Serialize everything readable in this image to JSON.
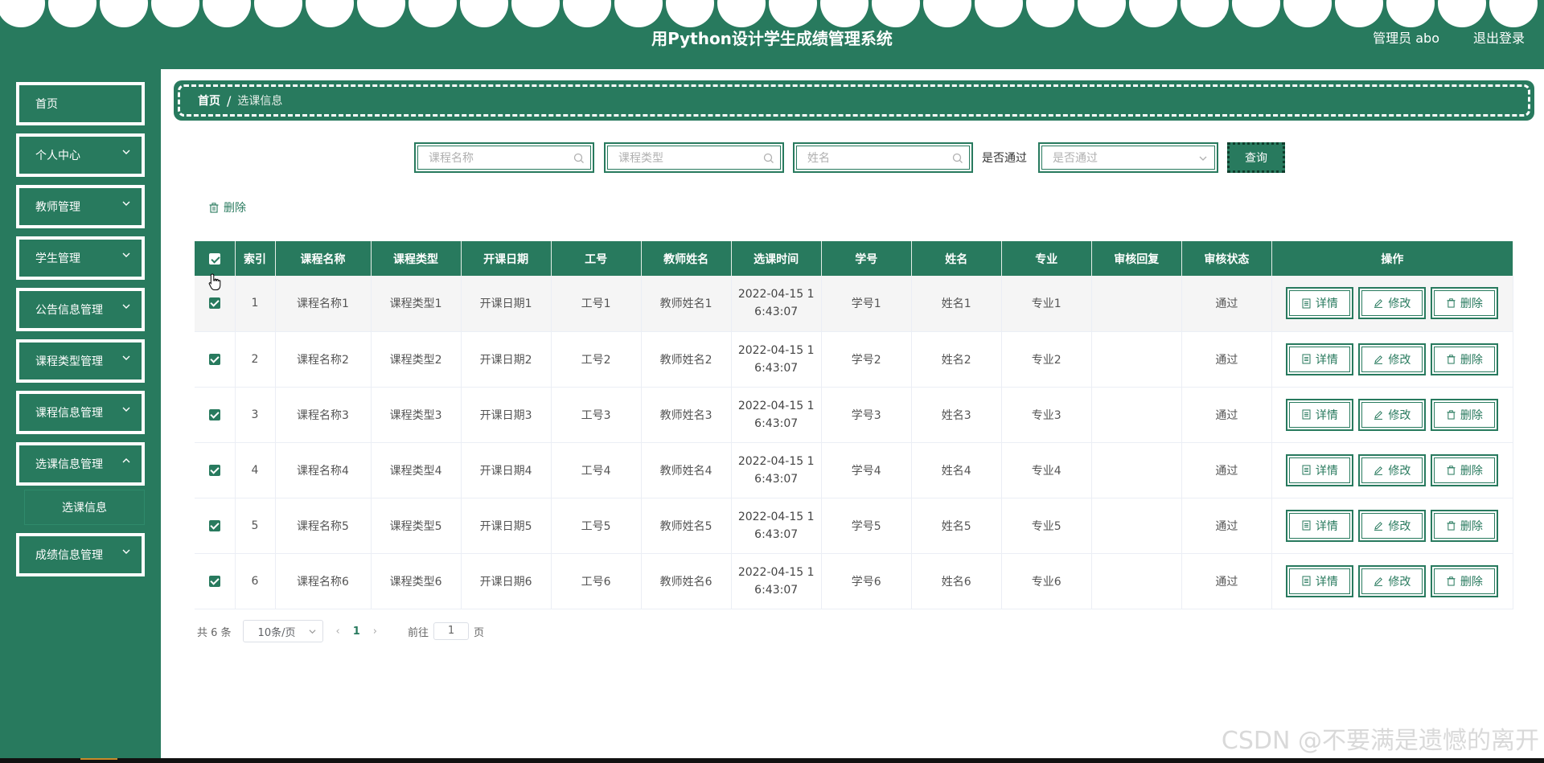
{
  "header": {
    "title": "用Python设计学生成绩管理系统",
    "user": "管理员 abo",
    "logout": "退出登录"
  },
  "sidebar": {
    "items": [
      {
        "label": "首页",
        "has_arrow": false
      },
      {
        "label": "个人中心",
        "has_arrow": true
      },
      {
        "label": "教师管理",
        "has_arrow": true
      },
      {
        "label": "学生管理",
        "has_arrow": true
      },
      {
        "label": "公告信息管理",
        "has_arrow": true
      },
      {
        "label": "课程类型管理",
        "has_arrow": true
      },
      {
        "label": "课程信息管理",
        "has_arrow": true
      },
      {
        "label": "选课信息管理",
        "has_arrow": true
      },
      {
        "label": "成绩信息管理",
        "has_arrow": true
      }
    ],
    "subitem": "选课信息"
  },
  "breadcrumb": {
    "home": "首页",
    "separator": "/",
    "current": "选课信息"
  },
  "search": {
    "course_name_placeholder": "课程名称",
    "course_type_placeholder": "课程类型",
    "name_placeholder": "姓名",
    "pass_label": "是否通过",
    "pass_placeholder": "是否通过",
    "query_button": "查询"
  },
  "toolbar": {
    "delete_label": "删除"
  },
  "table": {
    "headers": [
      "索引",
      "课程名称",
      "课程类型",
      "开课日期",
      "工号",
      "教师姓名",
      "选课时间",
      "学号",
      "姓名",
      "专业",
      "审核回复",
      "审核状态",
      "操作"
    ],
    "rows": [
      {
        "index": "1",
        "course": "课程名称1",
        "type": "课程类型1",
        "date": "开课日期1",
        "staff_no": "工号1",
        "teacher": "教师姓名1",
        "time_l1": "2022-04-15 1",
        "time_l2": "6:43:07",
        "student_no": "学号1",
        "name": "姓名1",
        "major": "专业1",
        "reply": "",
        "status": "通过"
      },
      {
        "index": "2",
        "course": "课程名称2",
        "type": "课程类型2",
        "date": "开课日期2",
        "staff_no": "工号2",
        "teacher": "教师姓名2",
        "time_l1": "2022-04-15 1",
        "time_l2": "6:43:07",
        "student_no": "学号2",
        "name": "姓名2",
        "major": "专业2",
        "reply": "",
        "status": "通过"
      },
      {
        "index": "3",
        "course": "课程名称3",
        "type": "课程类型3",
        "date": "开课日期3",
        "staff_no": "工号3",
        "teacher": "教师姓名3",
        "time_l1": "2022-04-15 1",
        "time_l2": "6:43:07",
        "student_no": "学号3",
        "name": "姓名3",
        "major": "专业3",
        "reply": "",
        "status": "通过"
      },
      {
        "index": "4",
        "course": "课程名称4",
        "type": "课程类型4",
        "date": "开课日期4",
        "staff_no": "工号4",
        "teacher": "教师姓名4",
        "time_l1": "2022-04-15 1",
        "time_l2": "6:43:07",
        "student_no": "学号4",
        "name": "姓名4",
        "major": "专业4",
        "reply": "",
        "status": "通过"
      },
      {
        "index": "5",
        "course": "课程名称5",
        "type": "课程类型5",
        "date": "开课日期5",
        "staff_no": "工号5",
        "teacher": "教师姓名5",
        "time_l1": "2022-04-15 1",
        "time_l2": "6:43:07",
        "student_no": "学号5",
        "name": "姓名5",
        "major": "专业5",
        "reply": "",
        "status": "通过"
      },
      {
        "index": "6",
        "course": "课程名称6",
        "type": "课程类型6",
        "date": "开课日期6",
        "staff_no": "工号6",
        "teacher": "教师姓名6",
        "time_l1": "2022-04-15 1",
        "time_l2": "6:43:07",
        "student_no": "学号6",
        "name": "姓名6",
        "major": "专业6",
        "reply": "",
        "status": "通过"
      }
    ],
    "actions": {
      "detail": "详情",
      "edit": "修改",
      "delete": "删除"
    }
  },
  "pagination": {
    "total": "共 6 条",
    "page_size": "10条/页",
    "current_page": "1",
    "goto_label": "前往",
    "goto_value": "1",
    "goto_suffix": "页"
  },
  "watermark": "CSDN @不要满是遗憾的离开",
  "colors": {
    "primary": "#287a5e",
    "white": "#ffffff"
  }
}
